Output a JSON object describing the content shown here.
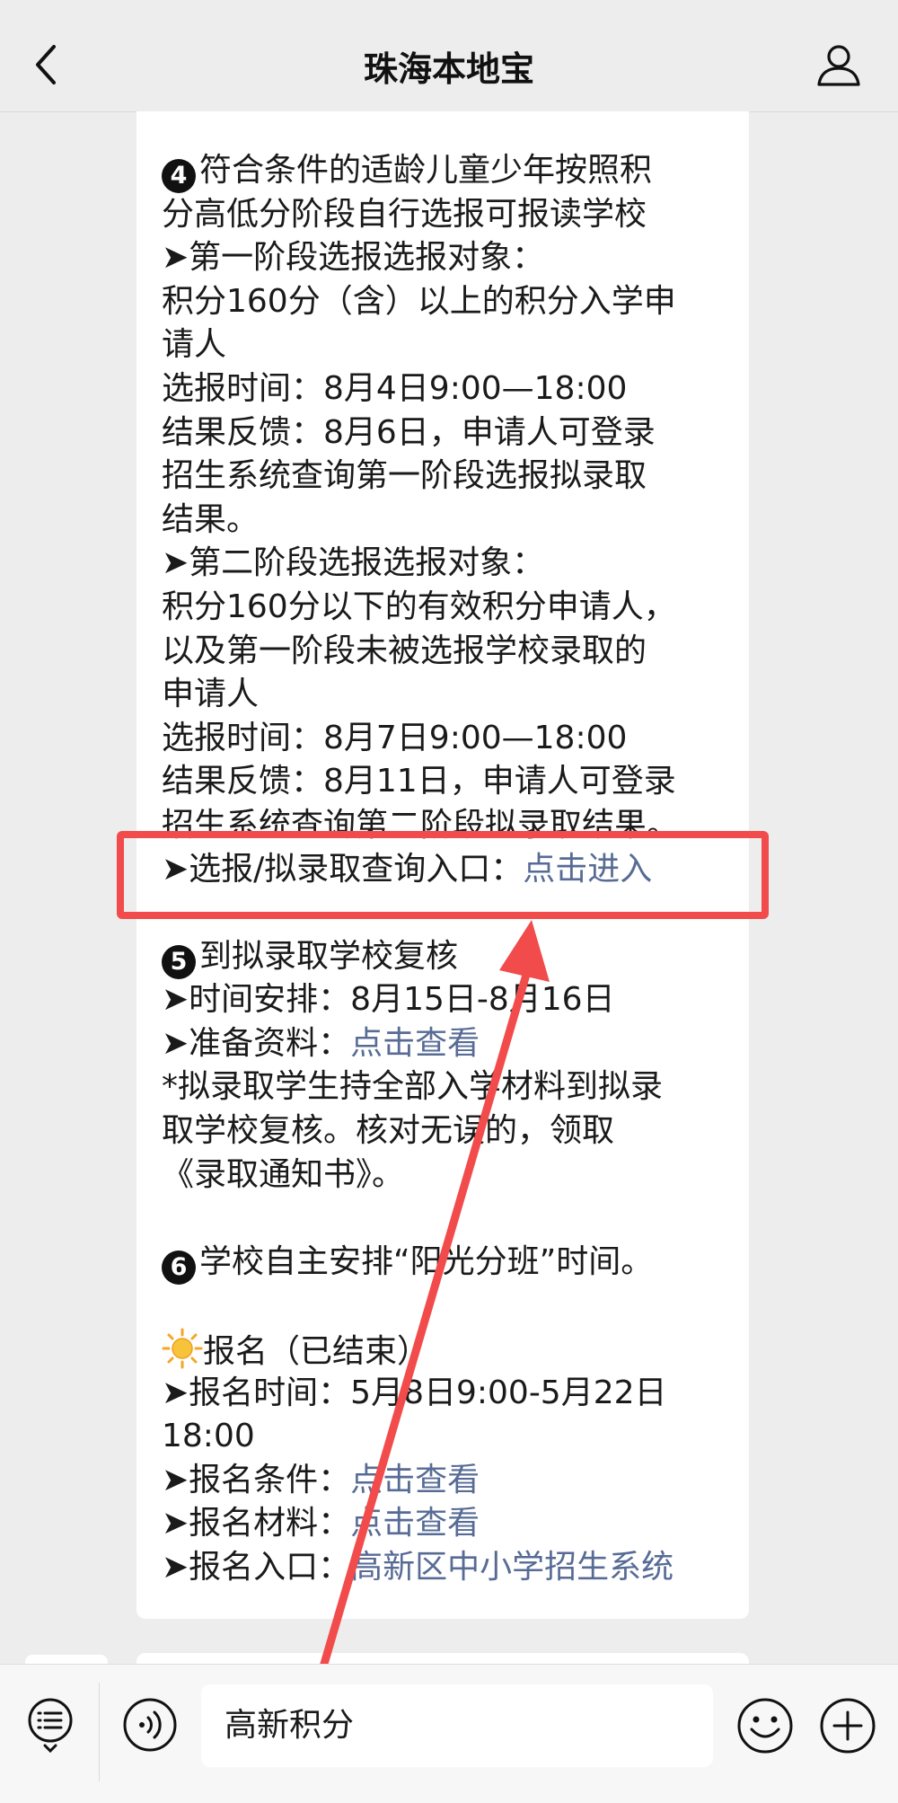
{
  "header": {
    "title": "珠海本地宝"
  },
  "colors": {
    "link": "#576b95",
    "highlight": "#f24b4b",
    "background": "#ededed"
  },
  "icons": {
    "back": "chevron-left-icon",
    "profile": "person-icon",
    "menu": "menu-list-icon",
    "voice": "voice-icon",
    "emoji": "emoji-icon",
    "plus": "plus-icon"
  },
  "article": {
    "s4_badge": "4",
    "s4_title_1": "符合条件的适龄儿童少年按照积",
    "s4_title_2": "分高低分阶段自行选报可报读学校",
    "p1_head": "➤第一阶段选报选报对象：",
    "p1_obj_1": "积分160分（含）以上的积分入学申",
    "p1_obj_2": "请人",
    "p1_time": "选报时间：8月4日9:00—18:00",
    "p1_res_1": "结果反馈：8月6日，申请人可登录",
    "p1_res_2": "招生系统查询第一阶段选报拟录取",
    "p1_res_3": "结果。",
    "p2_head": "➤第二阶段选报选报对象：",
    "p2_obj_1": "积分160分以下的有效积分申请人，",
    "p2_obj_2": "以及第一阶段未被选报学校录取的",
    "p2_obj_3": "申请人",
    "p2_time": "选报时间：8月7日9:00—18:00",
    "p2_res_1": "结果反馈：8月11日，申请人可登录",
    "p2_res_2": "招生系统查询第二阶段拟录取结果。",
    "query_label": "➤选报/拟录取查询入口：",
    "query_link": "点击进入",
    "s5_badge": "5",
    "s5_title": "到拟录取学校复核",
    "s5_time": "➤时间安排：8月15日-8月16日",
    "s5_prep_label": "➤准备资料：",
    "s5_prep_link": "点击查看",
    "s5_note_1": "*拟录取学生持全部入学材料到拟录",
    "s5_note_2": "取学校复核。核对无误的，领取",
    "s5_note_3": "《录取通知书》。",
    "s6_badge": "6",
    "s6_title": "学校自主安排“阳光分班”时间。",
    "reg_title": "报名（已结束）",
    "reg_time_1": "➤报名时间：5月8日9:00-5月22日",
    "reg_time_2": "18:00",
    "reg_cond_label": "➤报名条件：",
    "reg_cond_link": "点击查看",
    "reg_mat_label": "➤报名材料：",
    "reg_mat_link": "点击查看",
    "reg_entry_label": "➤报名入口：",
    "reg_entry_link": "高新区中小学招生系统"
  },
  "input": {
    "value": "高新积分"
  }
}
